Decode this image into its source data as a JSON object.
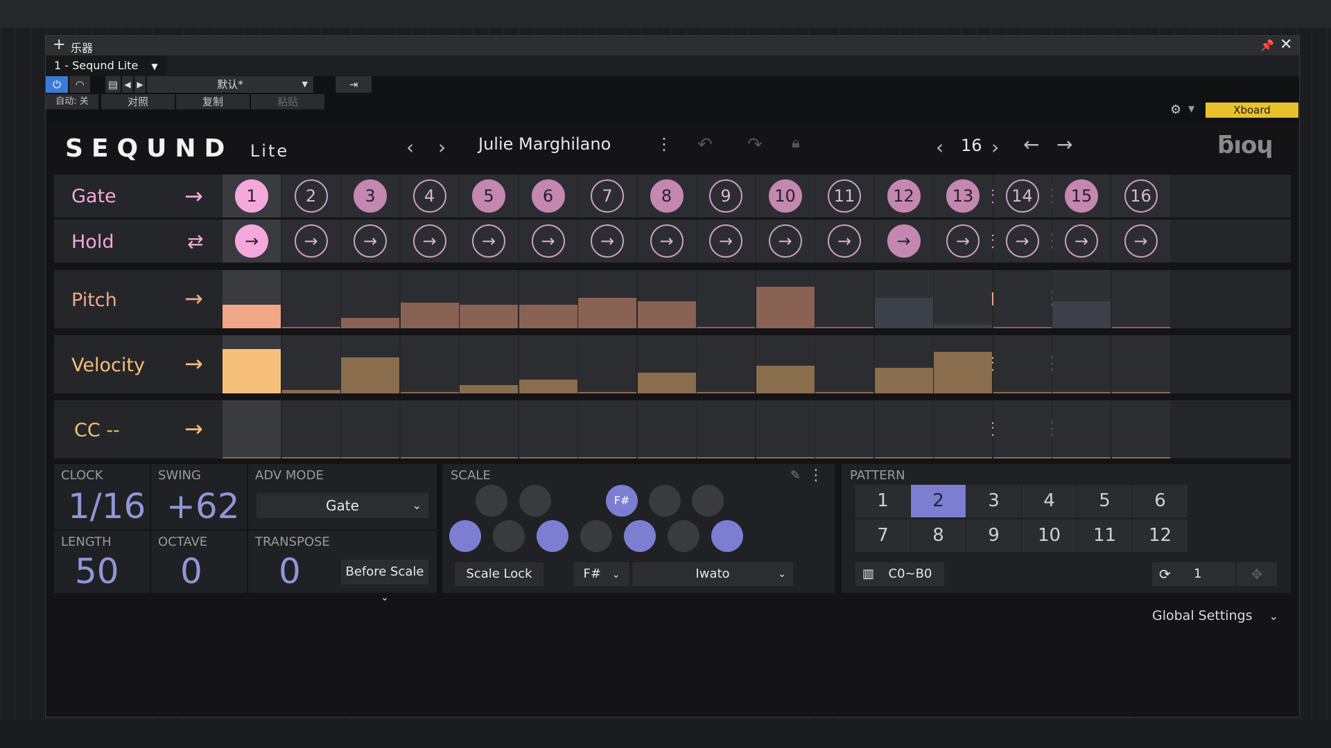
{
  "window": {
    "title": "乐器",
    "tab_label": "1 - Seqund Lite",
    "preset_name": "默认*",
    "auto_label": "自动: 关",
    "compare_label": "对照",
    "copy_label": "复制",
    "paste_label": "粘贴",
    "device_label": "Xboard"
  },
  "header": {
    "logo": "SEQUND",
    "logo_suffix": "Lite",
    "preset": "Julie Marghilano",
    "steps": "16"
  },
  "lanes": {
    "gate": {
      "label": "Gate",
      "length": "16",
      "steps": [
        "1",
        "2",
        "3",
        "4",
        "5",
        "6",
        "7",
        "8",
        "9",
        "10",
        "11",
        "12",
        "13",
        "14",
        "15",
        "16"
      ],
      "active": [
        true,
        false,
        true,
        false,
        true,
        true,
        false,
        true,
        false,
        true,
        false,
        true,
        true,
        false,
        true,
        false
      ]
    },
    "hold": {
      "label": "Hold",
      "length": "16",
      "active": [
        true,
        false,
        false,
        false,
        false,
        false,
        false,
        false,
        false,
        false,
        false,
        true,
        false,
        false,
        false,
        false
      ]
    },
    "pitch": {
      "label": "Pitch",
      "length": "11",
      "values": [
        0.4,
        0,
        0.18,
        0.44,
        0.41,
        0.41,
        0.52,
        0.46,
        0,
        0.72,
        0,
        0.52,
        0.06,
        0,
        0.46,
        0
      ],
      "inactive": [
        false,
        false,
        false,
        false,
        false,
        false,
        false,
        false,
        false,
        false,
        false,
        true,
        true,
        false,
        true,
        false
      ]
    },
    "velocity": {
      "label": "Velocity",
      "length": "16",
      "values": [
        0.76,
        0.06,
        0.62,
        0,
        0.14,
        0.24,
        0,
        0.36,
        0,
        0.48,
        0,
        0.44,
        0.71,
        0,
        0,
        0
      ]
    },
    "cc": {
      "label": "CC --",
      "length": "16"
    }
  },
  "settings": {
    "clock_label": "CLOCK",
    "clock": "1/16",
    "swing_label": "SWING",
    "swing": "+62",
    "adv_label": "ADV MODE",
    "adv_mode": "Gate",
    "length_label": "LENGTH",
    "length": "50",
    "octave_label": "OCTAVE",
    "octave": "0",
    "transpose_label": "TRANSPOSE",
    "transpose": "0",
    "transpose_mode": "Before Scale"
  },
  "scale": {
    "label": "SCALE",
    "root_note_label": "F#",
    "scale_lock": "Scale Lock",
    "root": "F#",
    "scale_name": "Iwato",
    "black_selected": [
      false,
      false,
      true,
      false,
      false
    ],
    "white_selected": [
      true,
      false,
      true,
      false,
      true,
      false,
      true
    ]
  },
  "pattern": {
    "label": "PATTERN",
    "cells": [
      "1",
      "2",
      "3",
      "4",
      "5",
      "6",
      "7",
      "8",
      "9",
      "10",
      "11",
      "12"
    ],
    "selected": 1,
    "range": "C0~B0",
    "repeat": "1"
  },
  "footer": {
    "global_settings": "Global Settings"
  },
  "colors": {
    "gate": "#f5a8dc",
    "pitch": "#f0a888",
    "velocity": "#f6c07a",
    "cc": "#f4c46a",
    "accent": "#7c7ed1",
    "xboard": "#e8c22c"
  }
}
